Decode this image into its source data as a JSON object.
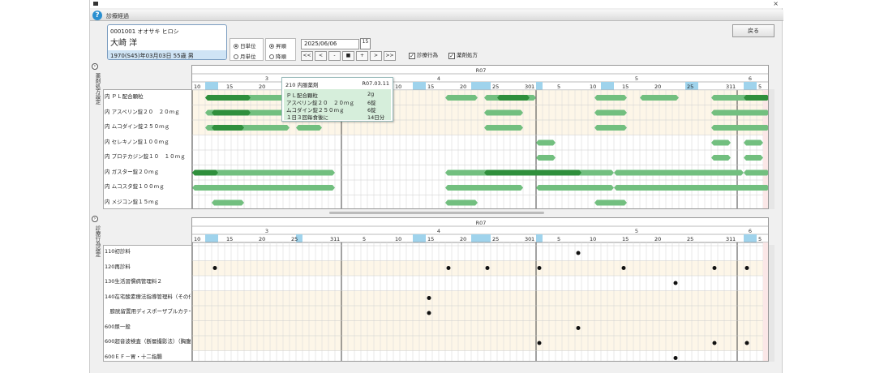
{
  "window": {
    "title": "診療経過",
    "close_glyph": "×",
    "help_glyph": "?"
  },
  "patient": {
    "id_kana": "0001001 オオサキ ヒロシ",
    "name": "大崎 洋",
    "dob": "1970(S45)年03月03日 55歳 男"
  },
  "unit_options": {
    "day": "日単位",
    "month": "月単位",
    "selected": "day"
  },
  "order_options": {
    "prev": "昇順",
    "asc": "降順",
    "selected": "prev"
  },
  "date": {
    "value": "2025/06/06",
    "cal_label": "15"
  },
  "nav_buttons": [
    "<<",
    "<",
    "-",
    "■",
    "+",
    ">",
    ">>"
  ],
  "checks": [
    {
      "label": "診療行為",
      "checked": true
    },
    {
      "label": "薬剤処方",
      "checked": true
    }
  ],
  "back_button": "戻る",
  "side_labels": {
    "top": "薬剤処方設定",
    "bottom": "診療行為設定"
  },
  "timeline": {
    "year": "R07",
    "months": [
      "3",
      "4",
      "5",
      "6"
    ],
    "days_top": [
      "10",
      "15",
      "20",
      "25",
      "31",
      "1",
      "5",
      "10",
      "15",
      "20",
      "25",
      "30",
      "1",
      "5",
      "10",
      "15",
      "20",
      "25",
      "31",
      "1",
      "5"
    ],
    "days_bottom": [
      "10",
      "15",
      "20",
      "25",
      "31",
      "1",
      "5",
      "10",
      "15",
      "20",
      "25",
      "30",
      "1",
      "5",
      "10",
      "15",
      "20",
      "25",
      "31",
      "1",
      "5"
    ]
  },
  "drugs": [
    "内 ＰＬ配合顆粒",
    "内 アスペリン錠２０　２０ｍｇ",
    "内 ムコダイン錠２５０ｍｇ",
    "内 セレキノン錠１００ｍｇ",
    "内 プロテカジン錠１０　１０ｍｇ",
    "内 ガスター錠２０ｍｇ",
    "内 ムコスタ錠１００ｍｇ",
    "内 メジコン錠１５ｍｇ"
  ],
  "procedures": [
    "110初診料",
    "120再診料",
    "130生活習慣病管理料２",
    "140在宅酸素療法指導管理料（その他）",
    "　膀胱留置用ディスポーザブルカテーテル（２管一般（１））",
    "600尿一般",
    "600超音波検査（断層撮影法）（胸腹部）",
    "600ＥＦ－胃・十二指腸"
  ],
  "tooltip": {
    "header": "210 内服薬剤",
    "date": "R07.03.11",
    "lines": [
      {
        "name": "ＰＬ配合顆粒",
        "qty": "2g"
      },
      {
        "name": "アスペリン錠２０　２０ｍｇ",
        "qty": "6錠"
      },
      {
        "name": "ムコダイン錠２５０ｍｇ",
        "qty": "6錠"
      },
      {
        "name": "１日３回毎食後に",
        "qty": "14日分"
      }
    ]
  },
  "colors": {
    "bar": "#72bf7f",
    "bar_dark": "#2f8f3c",
    "highlight": "#9fd3ec",
    "selected_row": "#fdf6e8"
  }
}
